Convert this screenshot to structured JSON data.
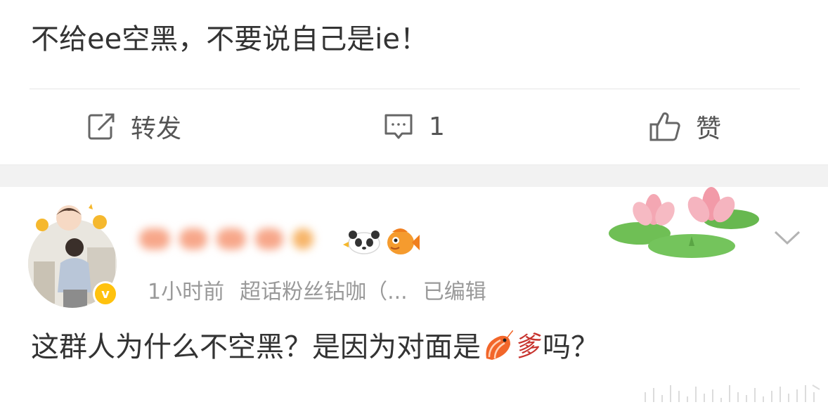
{
  "post": {
    "text": "不给ee空黑，不要说自己是ie！"
  },
  "actions": {
    "repost_label": "转发",
    "comment_count": "1",
    "like_label": "赞"
  },
  "comment": {
    "username": "",
    "time": "1小时前",
    "fan_tag": "超话粉丝钻咖（...",
    "edited": "已编辑",
    "text_before": "这群人为什么不空黑？是因为对面是",
    "text_emoji_char": "爹",
    "text_after": "吗？"
  },
  "icons": {
    "repost": "repost-icon",
    "comment": "comment-icon",
    "like": "thumbs-up-icon",
    "more": "chevron-down-icon",
    "verified": "verified-v-badge",
    "decoration": "lotus-decoration",
    "emoji": "shrimp-emoji"
  },
  "colors": {
    "text": "#333333",
    "muted": "#999999",
    "verified": "#ffc20e",
    "band": "#f2f2f2"
  }
}
